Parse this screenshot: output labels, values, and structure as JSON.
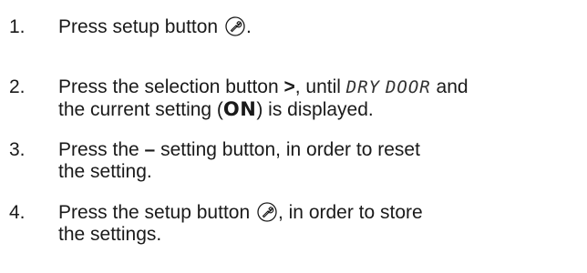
{
  "steps": [
    {
      "number": "1.",
      "lines": [
        {
          "before": "Press setup button ",
          "icon": "setup-wrench-icon",
          "after": "."
        }
      ]
    },
    {
      "number": "2.",
      "lines": [
        {
          "before": "Press the selection button ",
          "bold": ">",
          "middle": ", until ",
          "display1": "DRY",
          "gap": " ",
          "display2": "DOOR",
          "after": " and"
        },
        {
          "before": "the current setting (",
          "on": "ON",
          "after": ") is displayed."
        }
      ]
    },
    {
      "number": "3.",
      "lines": [
        {
          "before": "Press the ",
          "bold": "–",
          "after": " setting button, in order to reset"
        },
        {
          "before": "the setting."
        }
      ]
    },
    {
      "number": "4.",
      "lines": [
        {
          "before": "Press the setup button ",
          "icon": "setup-wrench-icon",
          "after": ", in order to store"
        },
        {
          "before": "the settings."
        }
      ]
    }
  ]
}
